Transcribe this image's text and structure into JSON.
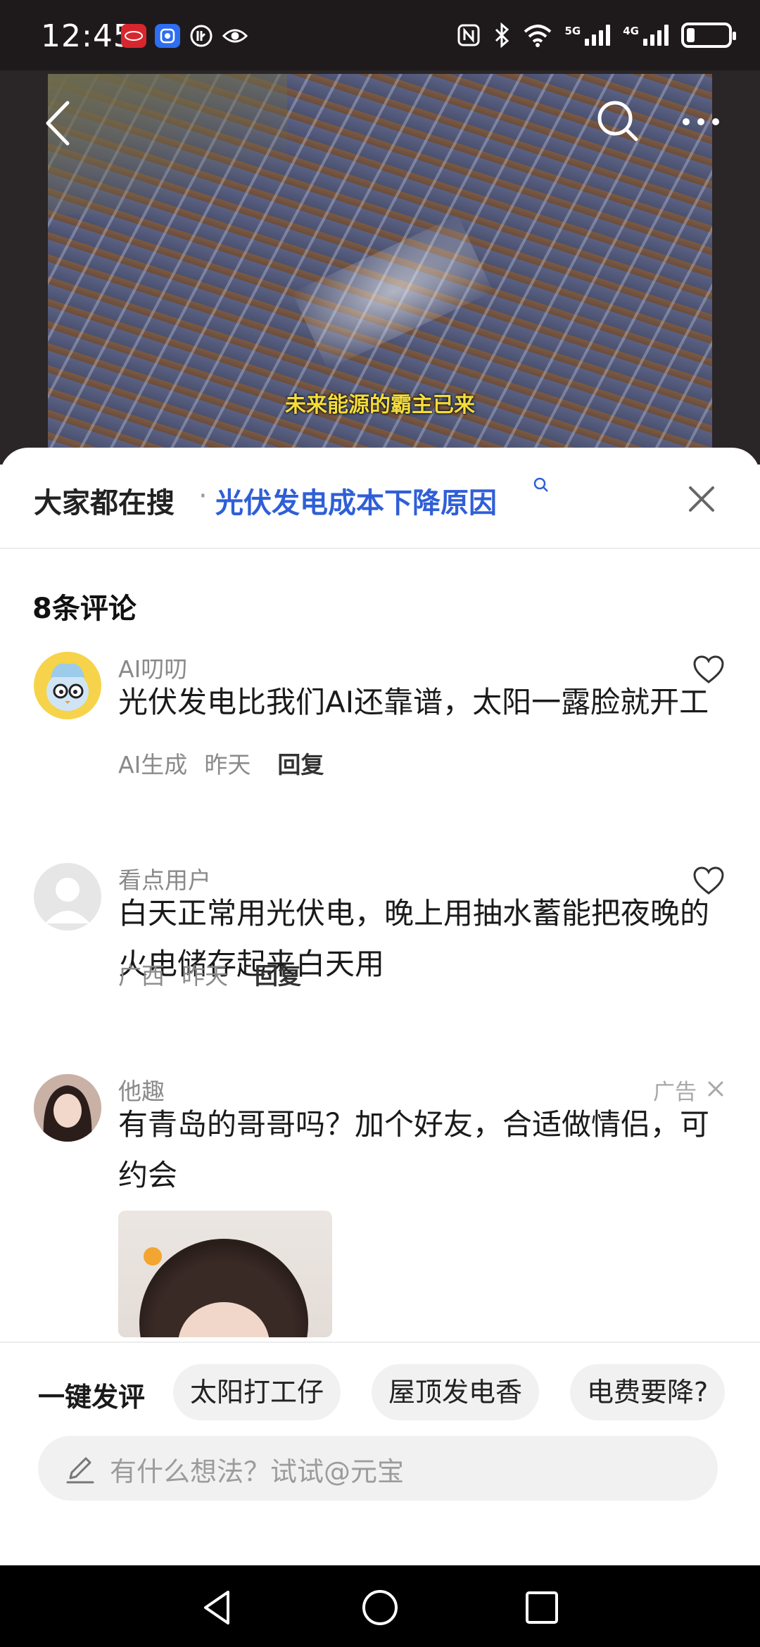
{
  "status_bar": {
    "time": "12:45",
    "app_icons": [
      "byd-app-icon",
      "notification-app-icon",
      "data-saver-icon",
      "eye-icon"
    ],
    "icons": [
      "nfc-icon",
      "bluetooth-icon",
      "wifi-icon",
      "signal-5g-icon",
      "signal-4g-icon",
      "battery-icon"
    ],
    "signal_5g_label": "5G",
    "signal_4g_label": "4G",
    "battery_level": 0.2
  },
  "video": {
    "caption": "未来能源的霸主已来",
    "icons": [
      "back-arrow-icon",
      "search-icon",
      "more-icon"
    ]
  },
  "search_suggestion": {
    "prefix": "大家都在搜",
    "separator": "·",
    "query": "光伏发电成本下降原因",
    "close_icon": "close-icon"
  },
  "comments_header": {
    "count_label": "8条评论"
  },
  "comments": [
    {
      "author": "AI叨叨",
      "text": "光伏发电比我们AI还靠谱，太阳一露脸就开工",
      "tag": "AI生成",
      "time": "昨天",
      "reply": "回复",
      "liked": false
    },
    {
      "author": "看点用户",
      "text": "白天正常用光伏电，晚上用抽水蓄能把夜晚的火电储存起来白天用",
      "location": "广西",
      "time": "昨天",
      "reply": "回复",
      "liked": false
    }
  ],
  "ad": {
    "author": "他趣",
    "label": "广告",
    "text": "有青岛的哥哥吗？加个好友，合适做情侣，可约会"
  },
  "composer": {
    "quick_label": "一键发评",
    "chips": [
      "太阳打工仔",
      "屋顶发电香",
      "电费要降?"
    ],
    "placeholder": "有什么想法？试试@元宝"
  },
  "nav_bar": {
    "buttons": [
      "back-triangle-icon",
      "home-circle-icon",
      "recents-square-icon"
    ]
  },
  "colors": {
    "accent_blue": "#2f5fd7",
    "caption_yellow": "#f4dc3b",
    "status_bg": "#1e1a1c"
  }
}
